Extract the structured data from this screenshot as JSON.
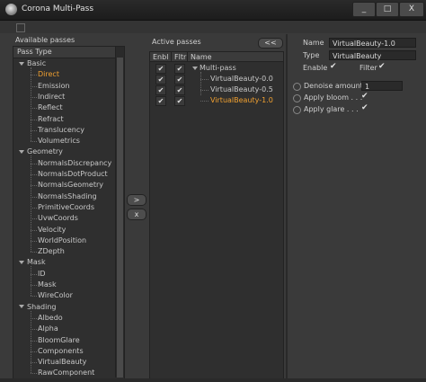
{
  "window": {
    "title": "Corona Multi-Pass",
    "controls": {
      "minimize": "_",
      "maximize": "□",
      "close": "X"
    }
  },
  "available": {
    "title": "Available passes",
    "column_header": "Pass Type",
    "groups": [
      {
        "label": "Basic",
        "items": [
          "Direct",
          "Emission",
          "Indirect",
          "Reflect",
          "Refract",
          "Translucency",
          "Volumetrics"
        ]
      },
      {
        "label": "Geometry",
        "items": [
          "NormalsDiscrepancy",
          "NormalsDotProduct",
          "NormalsGeometry",
          "NormalsShading",
          "PrimitiveCoords",
          "UvwCoords",
          "Velocity",
          "WorldPosition",
          "ZDepth"
        ]
      },
      {
        "label": "Mask",
        "items": [
          "ID",
          "Mask",
          "WireColor"
        ]
      },
      {
        "label": "Shading",
        "items": [
          "Albedo",
          "Alpha",
          "BloomGlare",
          "Components",
          "VirtualBeauty",
          "RawComponent"
        ]
      }
    ],
    "selected": "Direct"
  },
  "transfer": {
    "add": ">",
    "remove": "x"
  },
  "active": {
    "title": "Active passes",
    "collapse_label": "<<",
    "headers": {
      "enbl": "Enbl",
      "fltr": "Fltr",
      "name": "Name"
    },
    "rows": [
      {
        "name": "Multi-pass",
        "enbl": "✔",
        "fltr": "✔"
      },
      {
        "name": "VirtualBeauty-0.0",
        "enbl": "✔",
        "fltr": "✔"
      },
      {
        "name": "VirtualBeauty-0.5",
        "enbl": "✔",
        "fltr": "✔"
      },
      {
        "name": "VirtualBeauty-1.0",
        "enbl": "✔",
        "fltr": "✔"
      }
    ],
    "selected": "VirtualBeauty-1.0"
  },
  "props": {
    "name_label": "Name",
    "name_value": "VirtualBeauty-1.0",
    "type_label": "Type",
    "type_value": "VirtualBeauty",
    "enable_label": "Enable",
    "enable_check": "✔",
    "filter_label": "Filter",
    "filter_check": "✔",
    "denoise_label": "Denoise amount",
    "denoise_value": "1",
    "bloom_label": "Apply bloom . . .",
    "bloom_check": "✔",
    "glare_label": "Apply glare . . .",
    "glare_check": "✔"
  },
  "colors": {
    "selected_text": "#f0a030",
    "background": "#3a3a3a"
  }
}
